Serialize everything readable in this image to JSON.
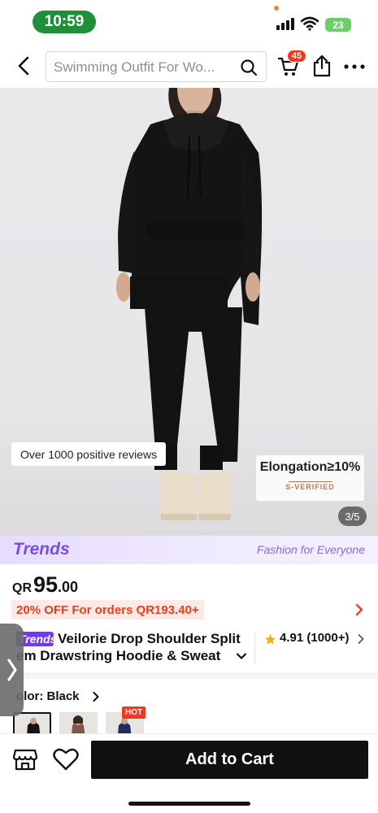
{
  "status_bar": {
    "time": "10:59",
    "battery": "23"
  },
  "header": {
    "search_placeholder": "Swimming Outfit For Wo...",
    "cart_count": "45"
  },
  "gallery": {
    "review_badge": "Over 1000 positive reviews",
    "elongation_title": "Elongation≥10%",
    "elongation_sub": "S-VERIFIED",
    "page_counter": "3/5"
  },
  "trends_banner": {
    "logo": "Trends",
    "tagline": "Fashion for Everyone"
  },
  "price": {
    "currency": "QR",
    "integer": "95",
    "decimal": ".00"
  },
  "promo": {
    "text": "20% OFF For orders QR193.40+"
  },
  "product": {
    "brand_tag": "Trends",
    "title_line1": "Veilorie Drop Shoulder Split",
    "title_line2": "em Drawstring Hoodie & Sweat",
    "rating": "4.91 (1000+)"
  },
  "color": {
    "label": "olor: Black",
    "hot_label": "HOT"
  },
  "bottom": {
    "add_to_cart": "Add to Cart"
  },
  "colors": {
    "accent": "#6f3bf0",
    "sale": "#e8401f",
    "badge": "#f0371f",
    "time_pill": "#1f8f3a"
  }
}
